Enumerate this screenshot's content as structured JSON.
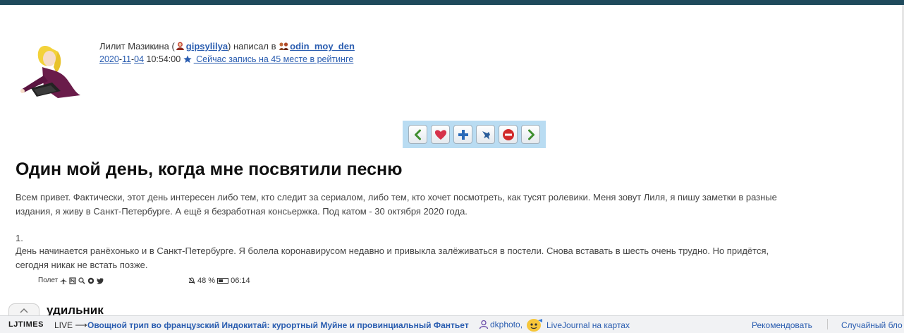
{
  "byline": {
    "author_name": "Лилит Мазикина (",
    "author_user": "gipsylilya",
    "posted_in": ") написал в ",
    "community": "odin_moy_den"
  },
  "meta": {
    "date_year": "2020",
    "dash1": "-",
    "date_month": "11",
    "dash2": "-",
    "date_day": "04",
    "time": " 10:54:00 ",
    "rating_text": " Сейчас запись на 45 месте в рейтинге"
  },
  "nav_icons": [
    "previous-arrow-icon",
    "heart-icon",
    "plus-icon",
    "pin-icon",
    "stop-icon",
    "next-arrow-icon"
  ],
  "post": {
    "title": "Один мой день, когда мне посвятили песню",
    "intro": "Всем привет. Фактически, этот день интересен либо тем, кто следит за сериалом, либо тем, кто хочет посмотреть, как тусят ролевики. Меня зовут Лиля, я пишу заметки в разные издания, я живу в Санкт-Петербурге. А ещё я безработная консьержка. Под катом - 30 октября 2020 года.",
    "item_number": "1.",
    "item_text": "День начинается ранёхонько и в Санкт-Петербурге. Я болела коронавирусом недавно и привыкла залёживаться в постели. Снова вставать в шесть очень трудно. Но придётся, сегодня никак не встать позже.",
    "clipped_heading": "удильник"
  },
  "phone_status": {
    "mode": "Полет",
    "battery_percent": "48 %",
    "battery_level": 0.48,
    "time": "06:14"
  },
  "footer": {
    "brand": "LJTIMES",
    "live_label": "LIVE ⟶",
    "headline": "Овощной трип во французский Индокитай: курортный Муйне и провинциальный Фантьет",
    "user": "dkphoto,",
    "map_link": "LiveJournal на картах",
    "recommend": "Рекомендовать",
    "random": "Случайный бло"
  },
  "colors": {
    "topbar": "#1f4a5c",
    "link": "#2a5db0",
    "nav_box": "#b9dcf2"
  }
}
